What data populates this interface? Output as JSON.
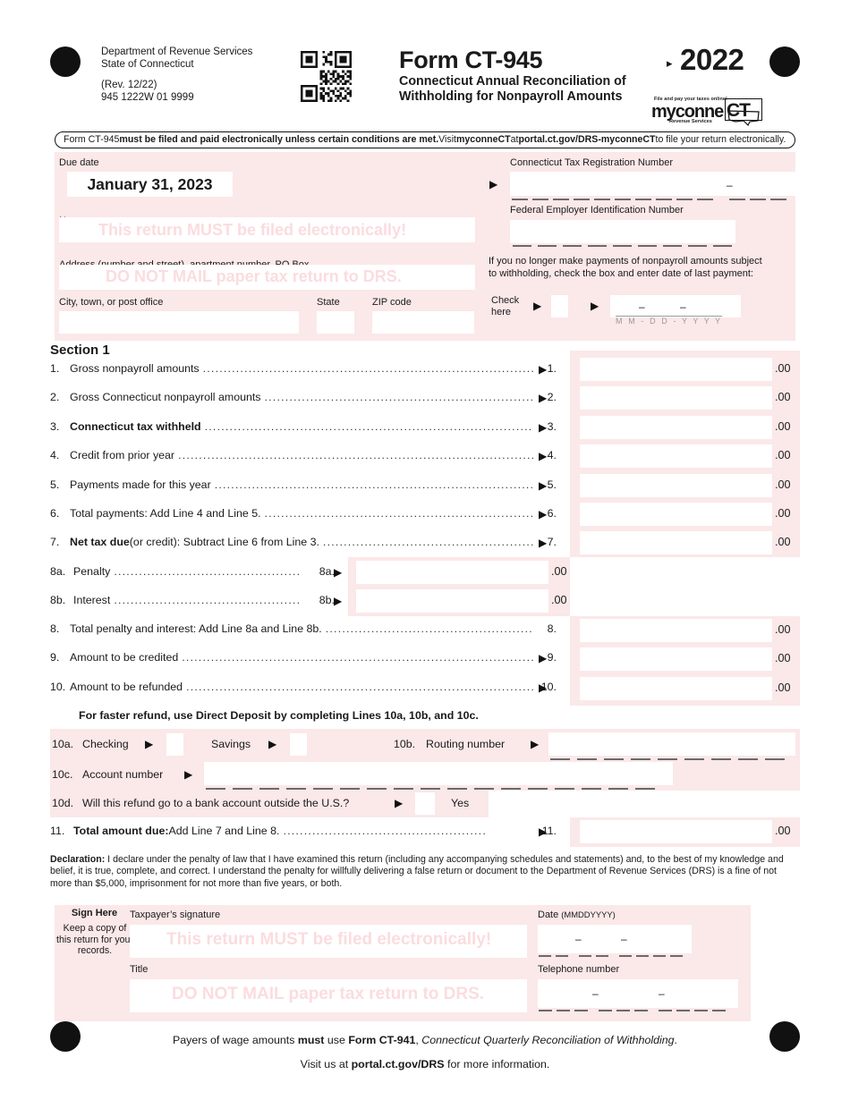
{
  "header": {
    "agency_line1": "Department of Revenue Services",
    "agency_line2": "State of Connecticut",
    "revision": "(Rev. 12/22)",
    "form_code": "945 1222W 01 9999",
    "form_title": "Form CT-945",
    "form_subtitle": "Connecticut Annual Reconciliation of Withholding for Nonpayroll Amounts",
    "year": "2022",
    "year_arrow": "▸",
    "qr_alt": "qr-code",
    "logo": {
      "tagline": "File and pay your taxes online!",
      "name_left": "myconne",
      "name_right": "CT",
      "subtitle": "Revenue Services"
    },
    "efile_banner": {
      "part1": "Form CT-945 ",
      "bold1": "must be filed and paid electronically unless certain conditions are met.",
      "part2": " Visit ",
      "bold2": "myconneCT",
      "part3": " at ",
      "bold3": "portal.ct.gov/DRS-myconneCT",
      "part4": " to file your return electronically."
    }
  },
  "watermarks": {
    "electronic": "This return MUST be filed electronically!",
    "donotmail": "DO NOT MAIL paper tax return to DRS."
  },
  "taxpayer": {
    "due_date_label": "Due date",
    "due_date_value": "January 31, 2023",
    "name_label": "Name",
    "address_label": "Address (number and street), apartment number, PO Box",
    "city_label": "City, town, or post office",
    "state_label": "State",
    "zip_label": "ZIP code",
    "ct_reg_label": "Connecticut Tax Registration Number",
    "fein_label": "Federal Employer Identification Number",
    "cease_note_line1": "If you no longer make payments of nonpayroll amounts subject",
    "cease_note_line2": "to withholding, check the box and enter date of last payment:",
    "check_here_line1": "Check",
    "check_here_line2": "here",
    "date_mask": "M M - D D - Y Y Y Y",
    "dash": "–",
    "arrow": "▶"
  },
  "section1": {
    "title": "Section 1",
    "lines": [
      {
        "no": "1.",
        "text": "Gross nonpayroll amounts",
        "bold_prefix": "",
        "ref": "1.",
        "cents": ".00"
      },
      {
        "no": "2.",
        "text": "Gross Connecticut nonpayroll amounts",
        "bold_prefix": "",
        "ref": "2.",
        "cents": ".00"
      },
      {
        "no": "3.",
        "text": "",
        "bold_prefix": "Connecticut tax withheld",
        "ref": "3.",
        "cents": ".00"
      },
      {
        "no": "4.",
        "text": "Credit from prior year",
        "bold_prefix": "",
        "ref": "4.",
        "cents": ".00"
      },
      {
        "no": "5.",
        "text": "Payments made for this year",
        "bold_prefix": "",
        "ref": "5.",
        "cents": ".00"
      },
      {
        "no": "6.",
        "text": "Total payments: Add Line 4 and Line 5.",
        "bold_prefix": "",
        "ref": "6.",
        "cents": ".00"
      },
      {
        "no": "7.",
        "text": " (or credit): Subtract Line 6 from Line 3.",
        "bold_prefix": "Net tax due",
        "ref": "7.",
        "cents": ".00"
      }
    ],
    "penalty": {
      "no": "8a.",
      "text": "Penalty",
      "ref": "8a.",
      "cents": ".00"
    },
    "interest": {
      "no": "8b.",
      "text": "Interest",
      "ref": "8b.",
      "cents": ".00"
    },
    "lines_b": [
      {
        "no": "8.",
        "text": "Total penalty and interest: Add Line 8a and Line 8b.",
        "ref": "8.",
        "cents": ".00",
        "arrow": false
      },
      {
        "no": "9.",
        "text": "Amount to be credited",
        "ref": "9.",
        "cents": ".00",
        "arrow": true
      },
      {
        "no": "10.",
        "text": "Amount to be refunded",
        "ref": "10.",
        "cents": ".00",
        "arrow": true
      }
    ]
  },
  "direct_deposit": {
    "promo": "For faster refund, use Direct Deposit by completing Lines 10a, 10b, and 10c.",
    "line10a_no": "10a.",
    "checking_label": "Checking",
    "savings_label": "Savings",
    "line10b_no": "10b.",
    "routing_label": "Routing number",
    "line10c_no": "10c.",
    "account_label": "Account number",
    "line10d_no": "10d.",
    "outside_us_label": "Will this refund go to a bank account outside the U.S.?",
    "yes_label": "Yes",
    "line11_no": "11.",
    "line11_bold": "Total amount due:",
    "line11_text": " Add Line 7 and Line 8.",
    "line11_ref": "11.",
    "line11_cents": ".00"
  },
  "declaration": {
    "label": "Declaration:",
    "body": " I declare under the penalty of law that I have examined this return (including any accompanying schedules and statements) and, to the best of my knowledge and belief, it is true, complete, and correct. I understand the penalty for willfully delivering a false return or document to the Department of Revenue Services (DRS) is a fine of not more than $5,000, imprisonment for not more than five years, or both."
  },
  "signature": {
    "sign_here": "Sign Here",
    "keep_copy": "Keep a copy of this return for your records.",
    "taxpayer_signature_label": "Taxpayer’s signature",
    "title_label": "Title",
    "date_label": "Date ",
    "date_format": "(MMDDYYYY)",
    "telephone_label": "Telephone number"
  },
  "footer": {
    "line1_a": "Payers of wage amounts ",
    "line1_must": "must",
    "line1_b": " use ",
    "line1_form": "Form CT-941",
    "line1_c": ", ",
    "line1_italic": "Connecticut Quarterly Reconciliation of Withholding",
    "line1_d": ".",
    "line2_a": "Visit us at ",
    "line2_url": "portal.ct.gov/DRS",
    "line2_b": " for more information."
  },
  "colors": {
    "pink_panel": "#fbe8e9",
    "watermark": "#fbdcdf",
    "field_white": "#ffffff",
    "ink": "#1a1a1a"
  }
}
